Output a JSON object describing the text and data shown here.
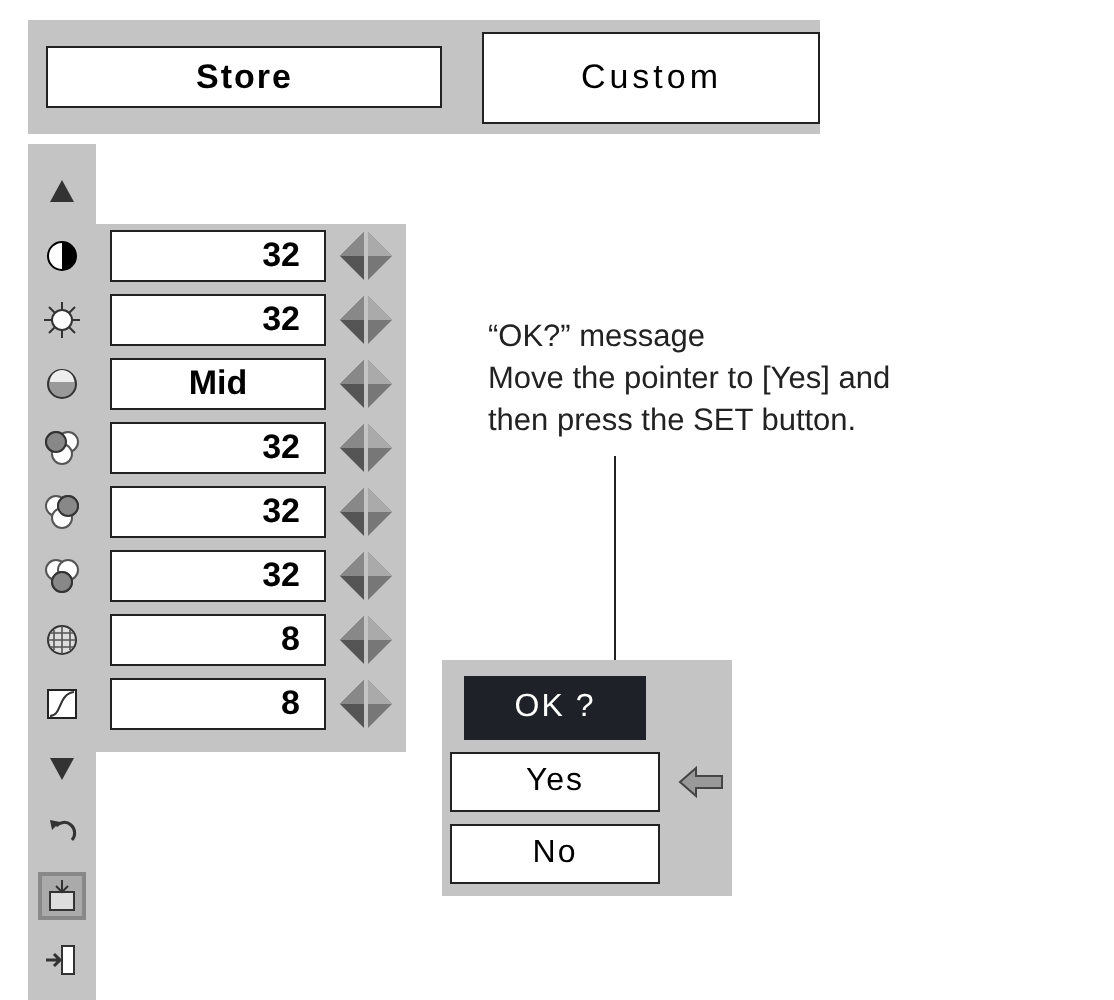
{
  "mode_buttons": [
    {
      "label": "Store",
      "selected": false
    },
    {
      "label": "Custom",
      "selected": true
    }
  ],
  "sidebar": [
    {
      "kind": "up",
      "selected": false
    },
    {
      "kind": "contrast",
      "selected": false
    },
    {
      "kind": "brightness",
      "selected": false
    },
    {
      "kind": "color-temp",
      "selected": false
    },
    {
      "kind": "red",
      "selected": false
    },
    {
      "kind": "green",
      "selected": false
    },
    {
      "kind": "blue",
      "selected": false
    },
    {
      "kind": "sharpness",
      "selected": false
    },
    {
      "kind": "gamma",
      "selected": false
    },
    {
      "kind": "down",
      "selected": false
    },
    {
      "kind": "reset",
      "selected": false
    },
    {
      "kind": "store",
      "selected": true
    },
    {
      "kind": "exit",
      "selected": false
    }
  ],
  "settings": [
    {
      "value": "32",
      "kind": "number"
    },
    {
      "value": "32",
      "kind": "number"
    },
    {
      "value": "Mid",
      "kind": "word"
    },
    {
      "value": "32",
      "kind": "number"
    },
    {
      "value": "32",
      "kind": "number"
    },
    {
      "value": "32",
      "kind": "number"
    },
    {
      "value": "8",
      "kind": "number"
    },
    {
      "value": "8",
      "kind": "number"
    }
  ],
  "callout": {
    "title": "“OK?” message",
    "text": "Move the pointer to [Yes] and then press the SET button."
  },
  "dialog": {
    "title": "OK ?",
    "options": [
      {
        "label": "Yes",
        "selected": true
      },
      {
        "label": "No",
        "selected": false
      }
    ]
  }
}
